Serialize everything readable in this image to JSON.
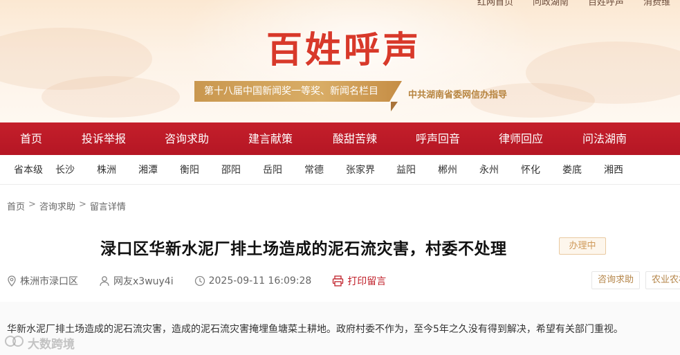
{
  "top_links": [
    "红网首页",
    "问政湖南",
    "百姓呼声",
    "消费维"
  ],
  "logo": {
    "title": "百姓呼声"
  },
  "award_ribbon": "第十八届中国新闻奖一等奖、新闻名栏目",
  "guide_text": "中共湖南省委网信办指导",
  "main_nav": [
    "首页",
    "投诉举报",
    "咨询求助",
    "建言献策",
    "酸甜苦辣",
    "呼声回音",
    "律师回应",
    "问法湖南"
  ],
  "city_nav": [
    "省本级",
    "长沙",
    "株洲",
    "湘潭",
    "衡阳",
    "邵阳",
    "岳阳",
    "常德",
    "张家界",
    "益阳",
    "郴州",
    "永州",
    "怀化",
    "娄底",
    "湘西"
  ],
  "breadcrumb": {
    "home": "首页",
    "section": "咨询求助",
    "current": "留言详情",
    "separator": ">"
  },
  "post": {
    "title": "渌口区华新水泥厂排土场造成的泥石流灾害，村委不处理",
    "status": "办理中",
    "location": "株洲市渌口区",
    "author": "网友x3wuy4i",
    "time": "2025-09-11 16:09:28",
    "print_label": "打印留言",
    "tags": [
      "咨询求助",
      "农业农村"
    ],
    "content": "华新水泥厂排土场造成的泥石流灾害，造成的泥石流灾害掩埋鱼塘菜土耕地。政府村委不作为，至今5年之久没有得到解决，希望有关部门重视。"
  },
  "watermark": {
    "text": "大数跨境"
  },
  "colors": {
    "nav_red": "#c41f2b",
    "logo_red": "#d8392a",
    "gold": "#c9974f",
    "print_red": "#c0202a"
  }
}
